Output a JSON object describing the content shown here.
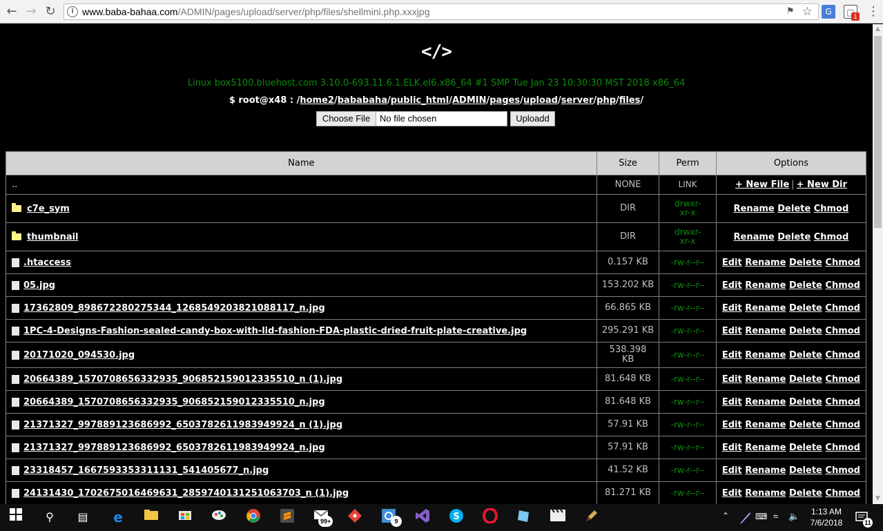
{
  "browser": {
    "url_host": "www.baba-bahaa.com",
    "url_path": "/ADMIN/pages/upload/server/php/files/shellmini.php.xxxjpg",
    "icons": [
      "back-arrow-icon",
      "forward-arrow-icon",
      "reload-icon",
      "info-icon",
      "blocked-icon",
      "star-icon",
      "translate-icon",
      "extension-icon",
      "menu-icon"
    ],
    "extension_badge": "1"
  },
  "header": {
    "logo": "</>",
    "uname": "Linux box5100.bluehost.com 3.10.0-693.11.6.1.ELK.el6.x86_64 #1 SMP Tue Jan 23 10:30:30 MST 2018 x86_64",
    "prompt": "$ root@x48 : ",
    "path_segments": [
      "home2",
      "bababaha",
      "public_html",
      "ADMIN",
      "pages",
      "upload",
      "server",
      "php",
      "files"
    ]
  },
  "upload": {
    "choose_label": "Choose File",
    "no_file": "No file chosen",
    "button": "Uploadd"
  },
  "table": {
    "headers": [
      "Name",
      "Size",
      "Perm",
      "Options"
    ],
    "parent": {
      "name": "..",
      "size": "NONE",
      "perm": "LINK",
      "new_file": "+ New File",
      "separator": "|",
      "new_dir": "+ New Dir"
    },
    "option_labels": {
      "edit": "Edit",
      "rename": "Rename",
      "delete": "Delete",
      "chmod": "Chmod"
    },
    "dirs": [
      {
        "name": "c7e_sym",
        "size": "DIR",
        "perm": "drwxr-xr-x"
      },
      {
        "name": "thumbnail",
        "size": "DIR",
        "perm": "drwxr-xr-x"
      }
    ],
    "files": [
      {
        "name": ".htaccess",
        "size": "0.157 KB",
        "perm": "-rw-r--r--"
      },
      {
        "name": "05.jpg",
        "size": "153.202 KB",
        "perm": "-rw-r--r--"
      },
      {
        "name": "17362809_898672280275344_1268549203821088117_n.jpg",
        "size": "66.865 KB",
        "perm": "-rw-r--r--"
      },
      {
        "name": "1PC-4-Designs-Fashion-sealed-candy-box-with-lid-fashion-FDA-plastic-dried-fruit-plate-creative.jpg",
        "size": "295.291 KB",
        "perm": "-rw-r--r--"
      },
      {
        "name": "20171020_094530.jpg",
        "size": "538.398 KB",
        "perm": "-rw-r--r--"
      },
      {
        "name": "20664389_1570708656332935_906852159012335510_n (1).jpg",
        "size": "81.648 KB",
        "perm": "-rw-r--r--"
      },
      {
        "name": "20664389_1570708656332935_906852159012335510_n.jpg",
        "size": "81.648 KB",
        "perm": "-rw-r--r--"
      },
      {
        "name": "21371327_997889123686992_6503782611983949924_n (1).jpg",
        "size": "57.91 KB",
        "perm": "-rw-r--r--"
      },
      {
        "name": "21371327_997889123686992_6503782611983949924_n.jpg",
        "size": "57.91 KB",
        "perm": "-rw-r--r--"
      },
      {
        "name": "23318457_1667593353311131_541405677_n.jpg",
        "size": "41.52 KB",
        "perm": "-rw-r--r--"
      },
      {
        "name": "24131430_1702675016469631_2859740131251063703_n (1).jpg",
        "size": "81.271 KB",
        "perm": "-rw-r--r--"
      }
    ]
  },
  "taskbar": {
    "apps": [
      "windows-start-icon",
      "search-icon",
      "task-view-icon",
      "edge-icon",
      "file-explorer-icon",
      "store-icon",
      "paint-icon",
      "chrome-icon",
      "sublime-icon",
      "mail-icon",
      "git-icon",
      "photos-icon",
      "visual-studio-icon",
      "skype-icon",
      "opera-icon",
      "notepad-icon",
      "video-icon",
      "pen-icon"
    ],
    "mail_badge": "99+",
    "photos_badge": "9",
    "time": "1:13 AM",
    "date": "7/6/2018",
    "notifications": "11"
  }
}
